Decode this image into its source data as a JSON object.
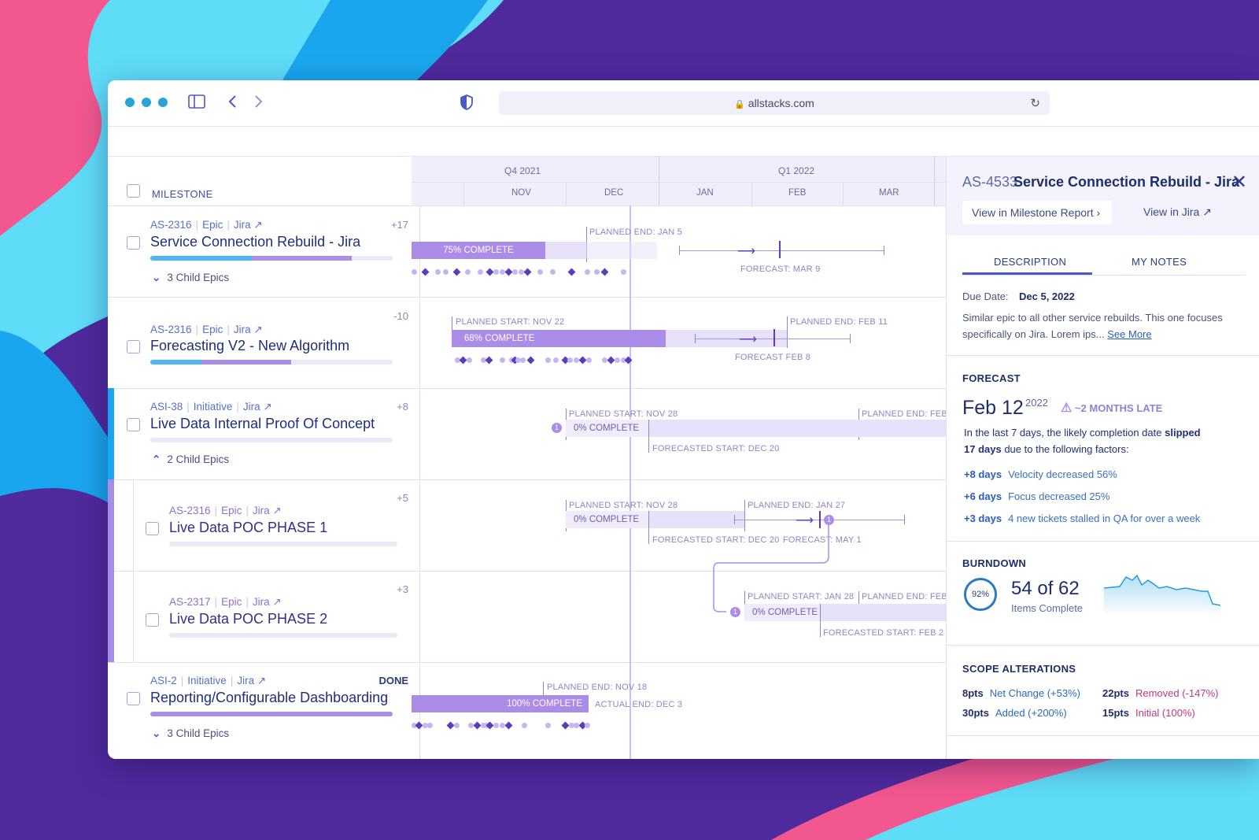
{
  "browser": {
    "url": "allstacks.com"
  },
  "milestone_header": "MILESTONE",
  "timeline": {
    "quarters": [
      "Q4 2021",
      "Q1 2022"
    ],
    "months": [
      "NOV",
      "DEC",
      "JAN",
      "FEB",
      "MAR"
    ]
  },
  "rows": [
    {
      "id": "AS-2316",
      "type": "Epic",
      "source": "Jira",
      "delta": "+17",
      "title": "Service Connection Rebuild - Jira",
      "children": "3 Child Epics",
      "progress": 0.42,
      "progress_b": 0.83,
      "labels": {
        "planned_end": "PLANNED END: JAN 5",
        "complete": "75% COMPLETE",
        "forecast": "FORECAST: MAR 9"
      }
    },
    {
      "id": "AS-2316",
      "type": "Epic",
      "source": "Jira",
      "delta": "-10",
      "title": "Forecasting V2 - New Algorithm",
      "progress": 0.21,
      "progress_b": 0.58,
      "labels": {
        "planned_start": "PLANNED START: NOV 22",
        "planned_end": "PLANNED END: FEB 11",
        "complete": "68% COMPLETE",
        "forecast": "FORECAST FEB 8"
      }
    },
    {
      "id": "ASI-38",
      "type": "Initiative",
      "source": "Jira",
      "delta": "+8",
      "title": "Live Data Internal Proof Of Concept",
      "children": "2 Child Epics",
      "progress": 0,
      "labels": {
        "planned_start": "PLANNED START: NOV 28",
        "planned_end": "PLANNED END: FEB",
        "complete": "0% COMPLETE",
        "forecasted_start": "FORECASTED START: DEC 20"
      }
    },
    {
      "id": "AS-2316",
      "type": "Epic",
      "source": "Jira",
      "delta": "+5",
      "title": "Live Data POC PHASE 1",
      "progress": 0,
      "labels": {
        "planned_start": "PLANNED START: NOV 28",
        "planned_end": "PLANNED END: JAN 27",
        "complete": "0% COMPLETE",
        "forecasted_start": "FORECASTED START: DEC 20",
        "forecast": "FORECAST: MAY 1"
      }
    },
    {
      "id": "AS-2317",
      "type": "Epic",
      "source": "Jira",
      "delta": "+3",
      "title": "Live Data POC PHASE 2",
      "progress": 0,
      "labels": {
        "planned_start": "PLANNED START: JAN 28",
        "planned_end": "PLANNED END: FEB",
        "complete": "0% COMPLETE",
        "forecasted_start": "FORECASTED START: FEB 2"
      }
    },
    {
      "id": "ASI-2",
      "type": "Initiative",
      "source": "Jira",
      "delta": "DONE",
      "title": "Reporting/Configurable Dashboarding",
      "children": "3 Child Epics",
      "progress": 1,
      "labels": {
        "planned_end": "PLANNED END: NOV 18",
        "complete": "100% COMPLETE",
        "actual_end": "ACTUAL END: DEC 3"
      }
    }
  ],
  "panel": {
    "id": "AS-4533",
    "title": "Service Connection Rebuild - Jira",
    "view_report": "View in Milestone Report",
    "view_jira": "View in Jira",
    "tabs": [
      "DESCRIPTION",
      "MY NOTES"
    ],
    "due_label": "Due Date:",
    "due_value": "Dec 5, 2022",
    "description": "Similar epic to all other service rebuilds. This one focuses specifically on Jira. Lorem ips...",
    "see_more": "See More",
    "forecast_header": "FORECAST",
    "forecast_date": "Feb 12",
    "forecast_year": "2022",
    "forecast_late": "~2 MONTHS LATE",
    "forecast_text_1": "In the last 7 days, the likely completion date",
    "forecast_text_slipped": "slipped",
    "forecast_text_days": "17 days",
    "forecast_text_2": "due to the following factors:",
    "factors": [
      {
        "days": "+8 days",
        "text": "Velocity decreased 56%"
      },
      {
        "days": "+6 days",
        "text": "Focus decreased 25%"
      },
      {
        "days": "+3 days",
        "text": "4 new tickets stalled in QA for over a week"
      }
    ],
    "burndown_header": "BURNDOWN",
    "burndown_pct": "92%",
    "burndown_count": "54 of 62",
    "burndown_sub": "Items Complete",
    "scope_header": "SCOPE ALTERATIONS",
    "scope": [
      {
        "pts": "8pts",
        "text": "Net Change (+53%)",
        "color": "#2a6ac0"
      },
      {
        "pts": "22pts",
        "text": "Removed (-147%)",
        "color": "#c23a7a"
      },
      {
        "pts": "30pts",
        "text": "Added (+200%)",
        "color": "#2a6ac0"
      },
      {
        "pts": "15pts",
        "text": "Initial (100%)",
        "color": "#c23a7a"
      }
    ]
  },
  "colors": {
    "accent": "#4fb6ef",
    "purple": "#a98de8",
    "dark": "#1e2e6a"
  }
}
